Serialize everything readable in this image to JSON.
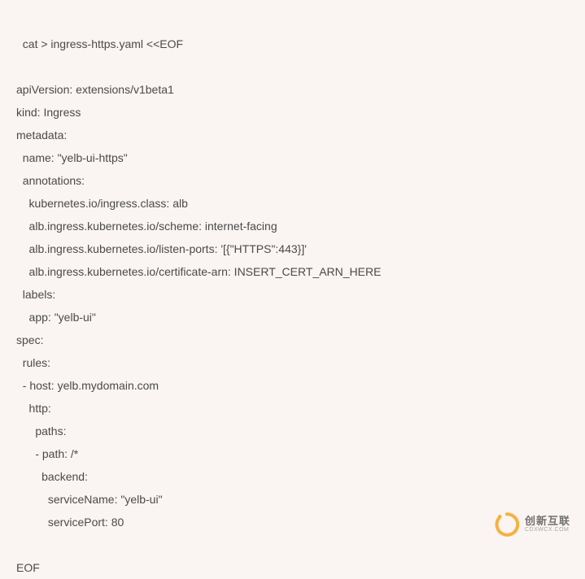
{
  "code": {
    "lines": [
      "cat > ingress-https.yaml <<EOF",
      "",
      "apiVersion: extensions/v1beta1",
      "kind: Ingress",
      "metadata:",
      "  name: \"yelb-ui-https\"",
      "  annotations:",
      "    kubernetes.io/ingress.class: alb",
      "    alb.ingress.kubernetes.io/scheme: internet-facing",
      "    alb.ingress.kubernetes.io/listen-ports: '[{\"HTTPS\":443}]'",
      "    alb.ingress.kubernetes.io/certificate-arn: INSERT_CERT_ARN_HERE",
      "  labels:",
      "    app: \"yelb-ui\"",
      "spec:",
      "  rules:",
      "  - host: yelb.mydomain.com",
      "    http:",
      "      paths:",
      "      - path: /*",
      "        backend:",
      "          serviceName: \"yelb-ui\"",
      "          servicePort: 80",
      "",
      "EOF"
    ]
  },
  "watermark": {
    "cn": "创新互联",
    "en": "CDXWCX.COM"
  }
}
